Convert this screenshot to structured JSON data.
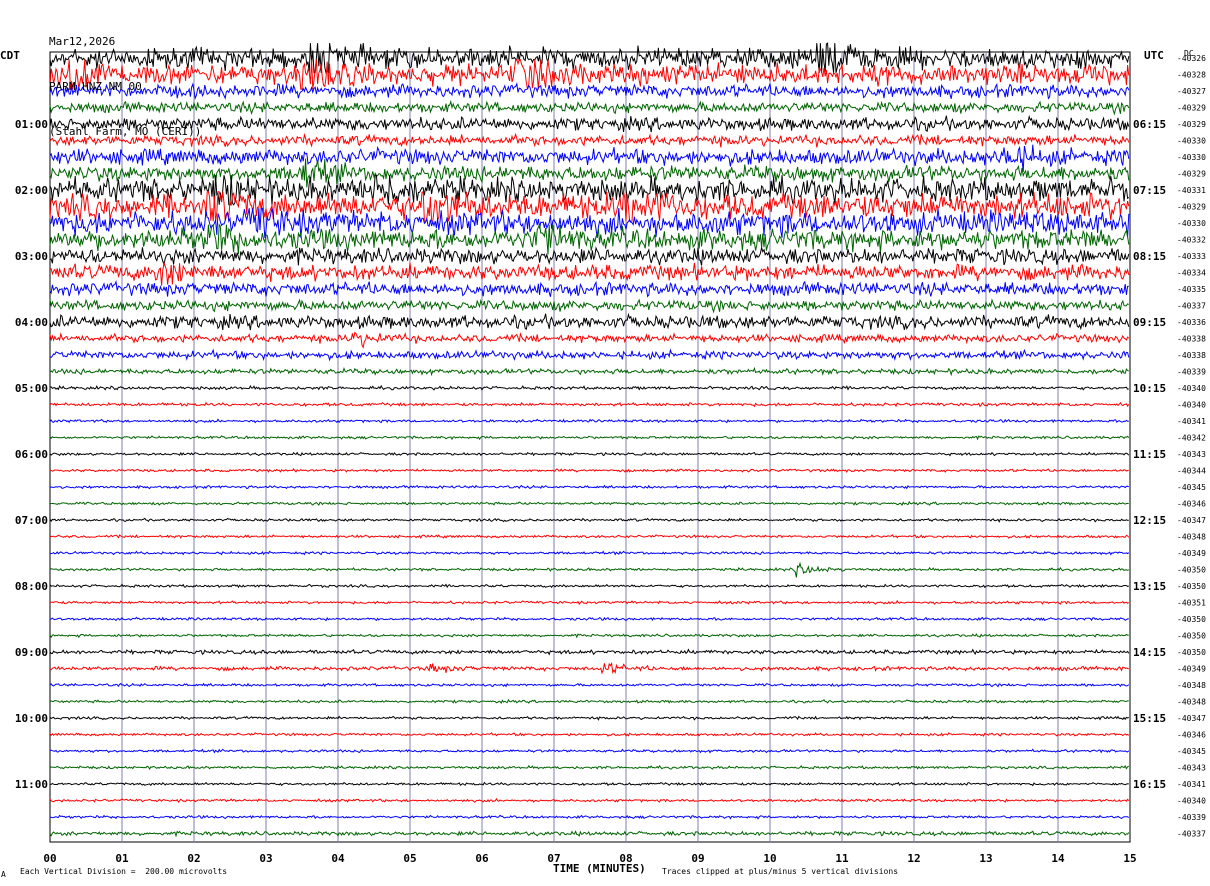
{
  "header": {
    "date": "Mar12,2026",
    "station": "PARM HNZ NM 00",
    "location": "(Stahl Farm, MO (CERI))"
  },
  "left_axis_label": "CDT",
  "right_axis_label": "UTC",
  "dc_label": "DC",
  "footer": {
    "scale_note": "Each Vertical Division =  200.00 microvolts",
    "clip_note": "Traces clipped at plus/minus 5 vertical divisions",
    "corner_mark": "A"
  },
  "colors": {
    "trace_cycle": [
      "#000000",
      "#ff0000",
      "#0000ff",
      "#006400"
    ],
    "grid": "#7f7fb0"
  },
  "chart_data": {
    "type": "line",
    "title": "PARM HNZ NM 00",
    "xlabel": "TIME (MINUTES)",
    "xlim": [
      0,
      15
    ],
    "x_ticks": [
      "00",
      "01",
      "02",
      "03",
      "04",
      "05",
      "06",
      "07",
      "08",
      "09",
      "10",
      "11",
      "12",
      "13",
      "14",
      "15"
    ],
    "left_time_labels": [
      "01:00",
      "02:00",
      "03:00",
      "04:00",
      "05:00",
      "06:00",
      "07:00",
      "08:00",
      "09:00",
      "10:00",
      "11:00"
    ],
    "right_time_labels": [
      "06:15",
      "07:15",
      "08:15",
      "09:15",
      "10:15",
      "11:15",
      "12:15",
      "13:15",
      "14:15",
      "15:15",
      "16:15"
    ],
    "trace_offsets": [
      "-40326",
      "-40328",
      "-40327",
      "-40329",
      "-40329",
      "-40330",
      "-40330",
      "-40329",
      "-40331",
      "-40329",
      "-40330",
      "-40332",
      "-40333",
      "-40334",
      "-40335",
      "-40337",
      "-40336",
      "-40338",
      "-40338",
      "-40339",
      "-40340",
      "-40340",
      "-40341",
      "-40342",
      "-40343",
      "-40344",
      "-40345",
      "-40346",
      "-40347",
      "-40348",
      "-40349",
      "-40350",
      "-40350",
      "-40351",
      "-40350",
      "-40350",
      "-40350",
      "-40349",
      "-40348",
      "-40348",
      "-40347",
      "-40346",
      "-40345",
      "-40343",
      "-40341",
      "-40340",
      "-40339",
      "-40337"
    ],
    "trace_amplitude": [
      8,
      8,
      5,
      4,
      5,
      4,
      6,
      6,
      9,
      10,
      9,
      8,
      6,
      6,
      5,
      4,
      5,
      3,
      3,
      2,
      1.2,
      1.2,
      1,
      1,
      1,
      1,
      1,
      1,
      1,
      1,
      1,
      1,
      1,
      1,
      1,
      1,
      1.5,
      1.5,
      1,
      1,
      1,
      1,
      1,
      1,
      1,
      1,
      1,
      1.5
    ],
    "events": [
      {
        "trace": 0,
        "minute": 3.6,
        "amp": 3
      },
      {
        "trace": 0,
        "minute": 10.7,
        "amp": 3
      },
      {
        "trace": 1,
        "minute": 0.3,
        "amp": 2
      },
      {
        "trace": 1,
        "minute": 3.5,
        "amp": 2.5
      },
      {
        "trace": 1,
        "minute": 6.5,
        "amp": 2
      },
      {
        "trace": 6,
        "minute": 13.3,
        "amp": 1.8
      },
      {
        "trace": 7,
        "minute": 3.5,
        "amp": 2
      },
      {
        "trace": 8,
        "minute": 2.3,
        "amp": 2
      },
      {
        "trace": 8,
        "minute": 4.5,
        "amp": 2
      },
      {
        "trace": 9,
        "minute": 2.2,
        "amp": 2
      },
      {
        "trace": 9,
        "minute": 5.2,
        "amp": 2.2
      },
      {
        "trace": 9,
        "minute": 8.0,
        "amp": 2
      },
      {
        "trace": 10,
        "minute": 2.8,
        "amp": 1.8
      },
      {
        "trace": 11,
        "minute": 2.2,
        "amp": 1.8
      },
      {
        "trace": 11,
        "minute": 6.8,
        "amp": 1.8
      },
      {
        "trace": 13,
        "minute": 1.5,
        "amp": 1.8
      },
      {
        "trace": 17,
        "minute": 4.2,
        "amp": 2
      },
      {
        "trace": 31,
        "minute": 10.4,
        "amp": 5
      },
      {
        "trace": 37,
        "minute": 7.7,
        "amp": 3
      },
      {
        "trace": 37,
        "minute": 5.3,
        "amp": 2
      }
    ]
  }
}
